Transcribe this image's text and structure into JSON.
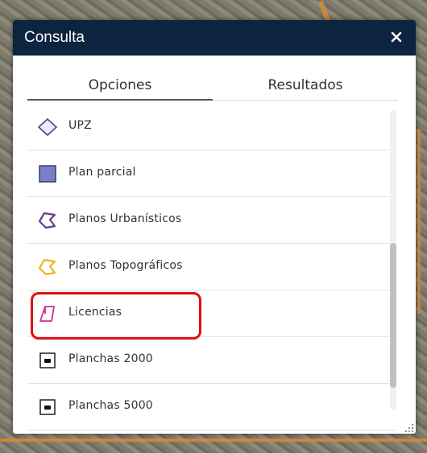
{
  "dialog": {
    "title": "Consulta",
    "close_icon": "close-icon"
  },
  "tabs": [
    {
      "label": "Opciones",
      "active": true
    },
    {
      "label": "Resultados",
      "active": false
    }
  ],
  "layers": [
    {
      "label": "UPZ",
      "icon": "diamond-outline-icon",
      "color": "#5a3d8a"
    },
    {
      "label": "Plan parcial",
      "icon": "filled-square-icon",
      "color": "#7b7fc4"
    },
    {
      "label": "Planos Urbanísticos",
      "icon": "polygon-outline-icon",
      "color": "#6a3c8c"
    },
    {
      "label": "Planos Topográficos",
      "icon": "polygon-outline-icon",
      "color": "#e8b820"
    },
    {
      "label": "Licencias",
      "icon": "quad-outline-icon",
      "color": "#d02c9a"
    },
    {
      "label": "Planchas 2000",
      "icon": "square-dot-icon",
      "color": "#111111"
    },
    {
      "label": "Planchas 5000",
      "icon": "square-dot-icon",
      "color": "#111111"
    }
  ],
  "highlight_color": "#e01010",
  "header_color": "#0c2440"
}
